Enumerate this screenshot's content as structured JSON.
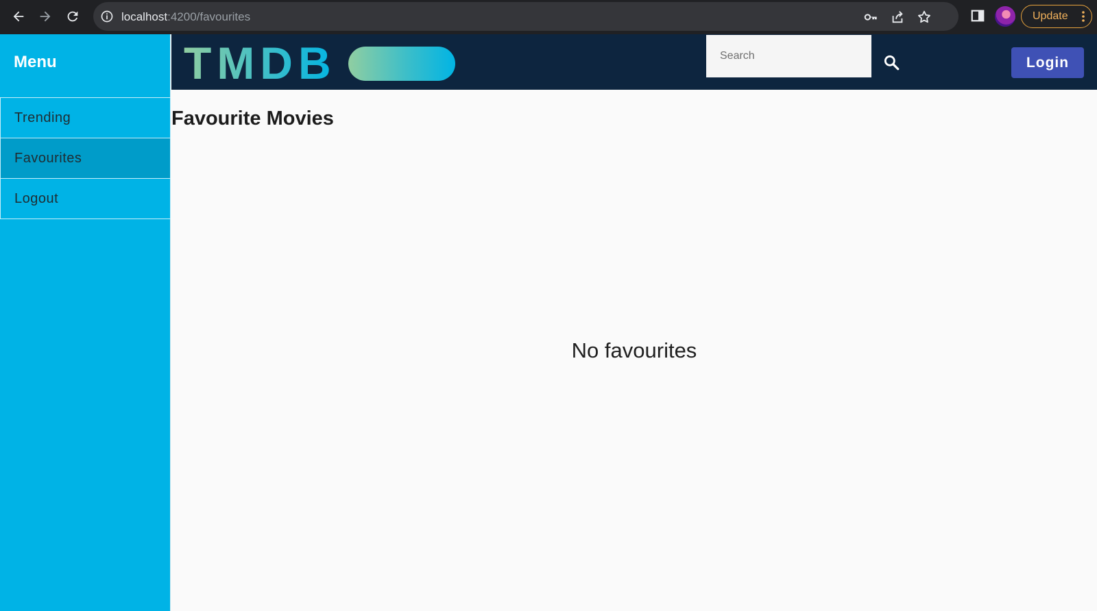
{
  "browser": {
    "url_host": "localhost",
    "url_path": ":4200/favourites",
    "update_label": "Update",
    "icons": [
      "back-arrow-icon",
      "forward-arrow-icon",
      "reload-icon",
      "info-icon",
      "key-icon",
      "share-icon",
      "star-icon",
      "side-panel-icon",
      "profile-avatar",
      "more-vert-icon"
    ]
  },
  "sidebar": {
    "title": "Menu",
    "items": [
      {
        "label": "Trending",
        "active": false
      },
      {
        "label": "Favourites",
        "active": true
      },
      {
        "label": "Logout",
        "active": false
      }
    ]
  },
  "header": {
    "logo_text": "TMDB",
    "search_placeholder": "Search",
    "search_icon": "search-icon",
    "login_label": "Login"
  },
  "main": {
    "title": "Favourite Movies",
    "empty_message": "No favourites"
  },
  "colors": {
    "sidebar_bg": "#00b3e6",
    "sidebar_active": "#009cc9",
    "header_bg": "#0d253f",
    "login_button": "#3f51b5",
    "logo_gradient_start": "#90cea1",
    "logo_gradient_end": "#01b4e4"
  }
}
